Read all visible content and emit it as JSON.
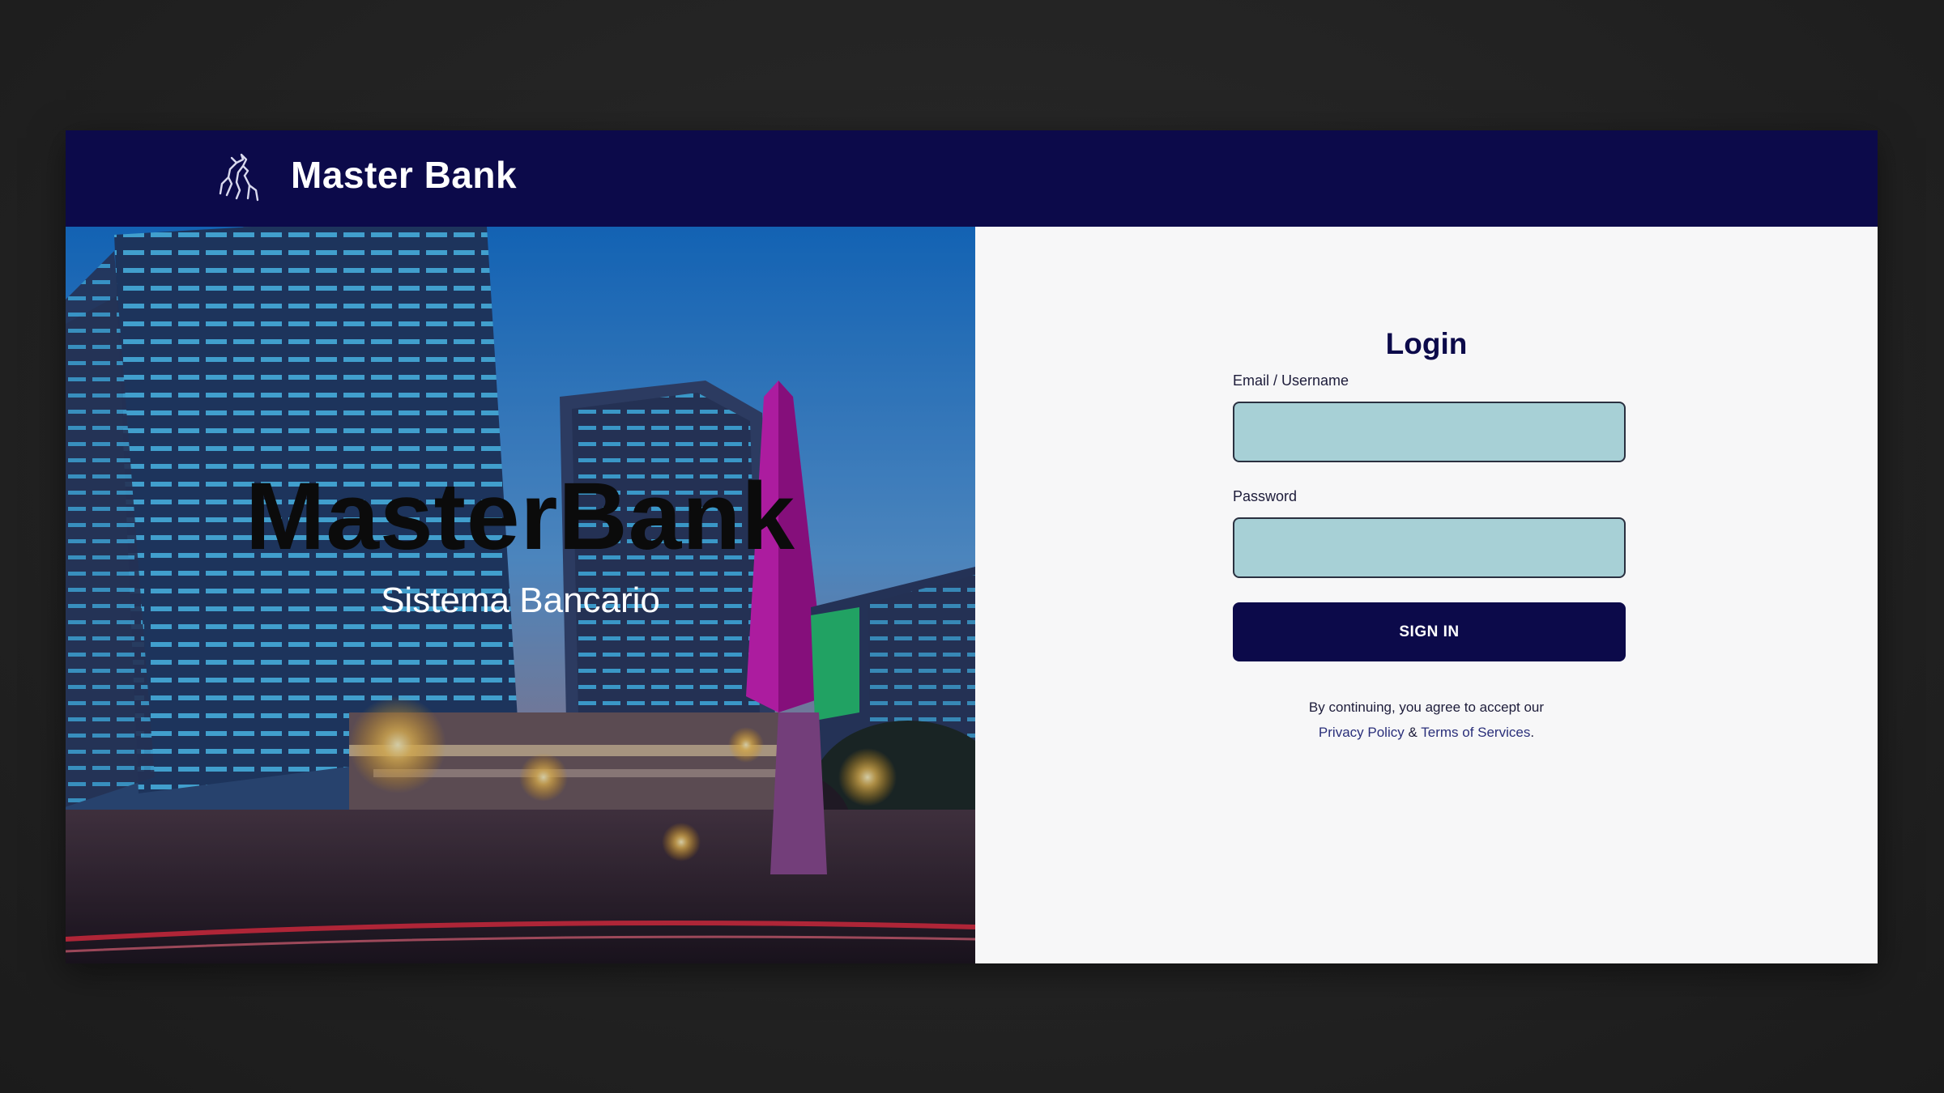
{
  "header": {
    "brand": "Master Bank",
    "logo_icon": "bull-logo-icon"
  },
  "hero": {
    "title": "MasterBank",
    "subtitle": "Sistema Bancario"
  },
  "login": {
    "title": "Login",
    "email_label": "Email / Username",
    "email_value": "",
    "password_label": "Password",
    "password_value": "",
    "submit_label": "SIGN IN",
    "legal_text": "By continuing, you agree to accept our",
    "privacy_link": "Privacy Policy",
    "amp": "&",
    "terms_link": "Terms of Services",
    "period": "."
  },
  "colors": {
    "navy": "#0c0a4a",
    "input_bg": "#a7d0d6",
    "panel_bg": "#f7f7f8"
  }
}
